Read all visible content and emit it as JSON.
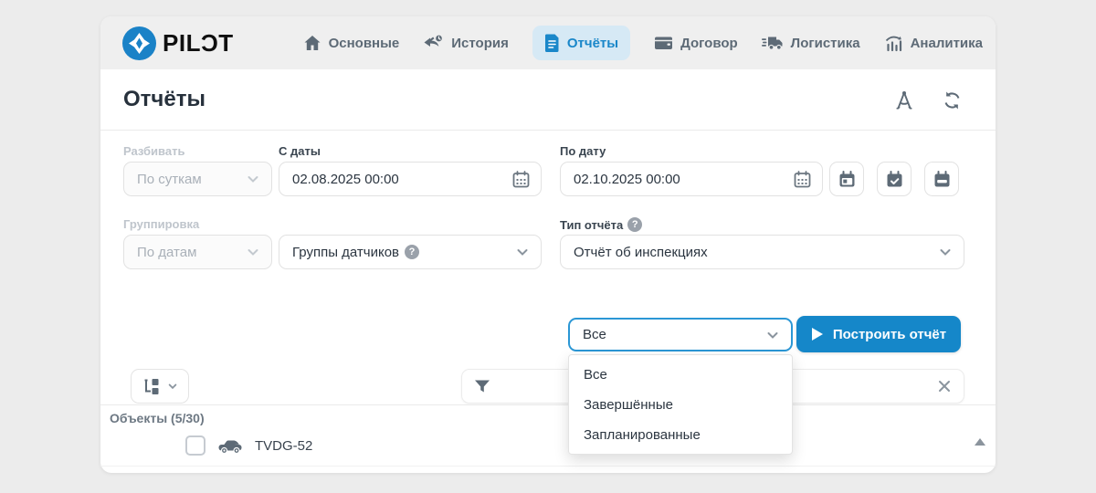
{
  "colors": {
    "accent": "#1a87c9",
    "active_tab_bg": "#d6e9f5",
    "button_bg": "#1587c9",
    "page_bg": "#ececec",
    "navbar_bg": "#efefef"
  },
  "logo": {
    "text": "PILƆT"
  },
  "nav": {
    "items": [
      {
        "label": "Основные",
        "icon": "home-icon"
      },
      {
        "label": "История",
        "icon": "history-icon"
      },
      {
        "label": "Отчёты",
        "icon": "document-icon",
        "active": true
      },
      {
        "label": "Договор",
        "icon": "wallet-icon"
      },
      {
        "label": "Логистика",
        "icon": "truck-icon"
      },
      {
        "label": "Аналитика",
        "icon": "analytics-icon"
      }
    ]
  },
  "header": {
    "title": "Отчёты"
  },
  "filters": {
    "breakdown": {
      "label": "Разбивать",
      "value": "По суткам",
      "disabled": true
    },
    "date_from": {
      "label": "С даты",
      "value": "02.08.2025 00:00"
    },
    "date_to": {
      "label": "По дату",
      "value": "02.10.2025 00:00"
    },
    "grouping": {
      "label": "Группировка",
      "value": "По датам",
      "disabled": true
    },
    "sensor_groups": {
      "value": "Группы датчиков"
    },
    "report_type": {
      "label": "Тип отчёта",
      "value": "Отчёт об инспекциях"
    },
    "status": {
      "value": "Все"
    },
    "build_button_label": "Построить отчёт"
  },
  "dropdown": {
    "options": [
      "Все",
      "Завершённые",
      "Запланированные"
    ]
  },
  "objects": {
    "title": "Объекты (5/30)",
    "rows": [
      {
        "name": "TVDG-52"
      }
    ]
  }
}
